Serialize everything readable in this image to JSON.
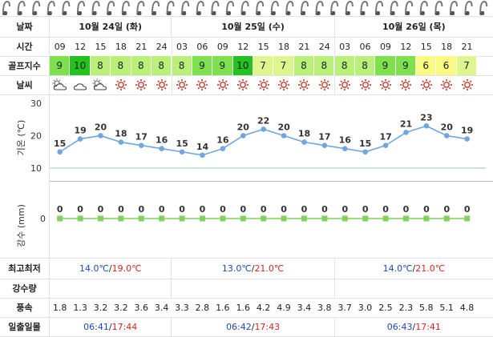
{
  "labels": {
    "date": "날짜",
    "time": "시간",
    "golf_index": "골프지수",
    "weather": "날씨",
    "temp_axis": "기온 (℃)",
    "rain_axis": "강수 (mm)",
    "min_max": "최고최저",
    "precip": "강수량",
    "wind": "풍속",
    "sun": "일출일몰"
  },
  "days": [
    {
      "label": "10월 24일 (화)",
      "low": "14.0℃",
      "high": "19.0℃",
      "sunrise": "06:41",
      "sunset": "17:44"
    },
    {
      "label": "10월 25일 (수)",
      "low": "13.0℃",
      "high": "21.0℃",
      "sunrise": "06:42",
      "sunset": "17:43"
    },
    {
      "label": "10월 26일 (목)",
      "low": "14.0℃",
      "high": "21.0℃",
      "sunrise": "06:43",
      "sunset": "17:41"
    }
  ],
  "hours": [
    "09",
    "12",
    "15",
    "18",
    "21",
    "24",
    "03",
    "06",
    "09",
    "12",
    "15",
    "18",
    "21",
    "24",
    "03",
    "06",
    "09",
    "12",
    "15",
    "18",
    "21"
  ],
  "golf": [
    9,
    10,
    8,
    8,
    8,
    8,
    8,
    9,
    9,
    10,
    7,
    7,
    8,
    8,
    8,
    8,
    9,
    9,
    6,
    6,
    7
  ],
  "weather_icons": [
    "partly-cloudy-icon",
    "cloudy-icon",
    "partly-cloudy-icon",
    "sun-icon",
    "sun-icon",
    "sun-icon",
    "sun-icon",
    "sun-icon",
    "sun-icon",
    "sun-icon",
    "sun-icon",
    "sun-icon",
    "sun-icon",
    "sun-icon",
    "sun-icon",
    "sun-icon",
    "sun-icon",
    "sun-icon",
    "sun-icon",
    "sun-icon",
    "sun-icon"
  ],
  "wind": [
    "1.8",
    "1.3",
    "3.2",
    "3.2",
    "3.6",
    "3.4",
    "3.3",
    "2.8",
    "1.6",
    "1.6",
    "4.2",
    "4.9",
    "3.4",
    "3.8",
    "3.7",
    "3.0",
    "2.5",
    "2.3",
    "5.8",
    "5.1",
    "4.8"
  ],
  "colors": {
    "golf_10": "#23c21f",
    "golf_9": "#7ee04f",
    "golf_8": "#b9f07a",
    "golf_7": "#dff58e",
    "golf_6": "#fafa82",
    "temp_line": "#6fa6e0",
    "rain_line": "#7fd35a",
    "sun_icon": "#c0392b"
  },
  "chart_data": [
    {
      "type": "line",
      "title": "",
      "ylabel": "기온 (℃)",
      "x": [
        "09",
        "12",
        "15",
        "18",
        "21",
        "24",
        "03",
        "06",
        "09",
        "12",
        "15",
        "18",
        "21",
        "24",
        "03",
        "06",
        "09",
        "12",
        "15",
        "18",
        "21"
      ],
      "series": [
        {
          "values": [
            15,
            19,
            20,
            18,
            17,
            16,
            15,
            14,
            16,
            20,
            22,
            20,
            18,
            17,
            16,
            15,
            17,
            21,
            23,
            20,
            19
          ]
        }
      ],
      "ylim": [
        10,
        30
      ],
      "yticks": [
        "10",
        "20",
        "30"
      ]
    },
    {
      "type": "line",
      "title": "",
      "ylabel": "강수 (mm)",
      "x": [
        "09",
        "12",
        "15",
        "18",
        "21",
        "24",
        "03",
        "06",
        "09",
        "12",
        "15",
        "18",
        "21",
        "24",
        "03",
        "06",
        "09",
        "12",
        "15",
        "18",
        "21"
      ],
      "series": [
        {
          "values": [
            0,
            0,
            0,
            0,
            0,
            0,
            0,
            0,
            0,
            0,
            0,
            0,
            0,
            0,
            0,
            0,
            0,
            0,
            0,
            0,
            0
          ]
        }
      ],
      "yticks": [
        "0"
      ]
    }
  ]
}
